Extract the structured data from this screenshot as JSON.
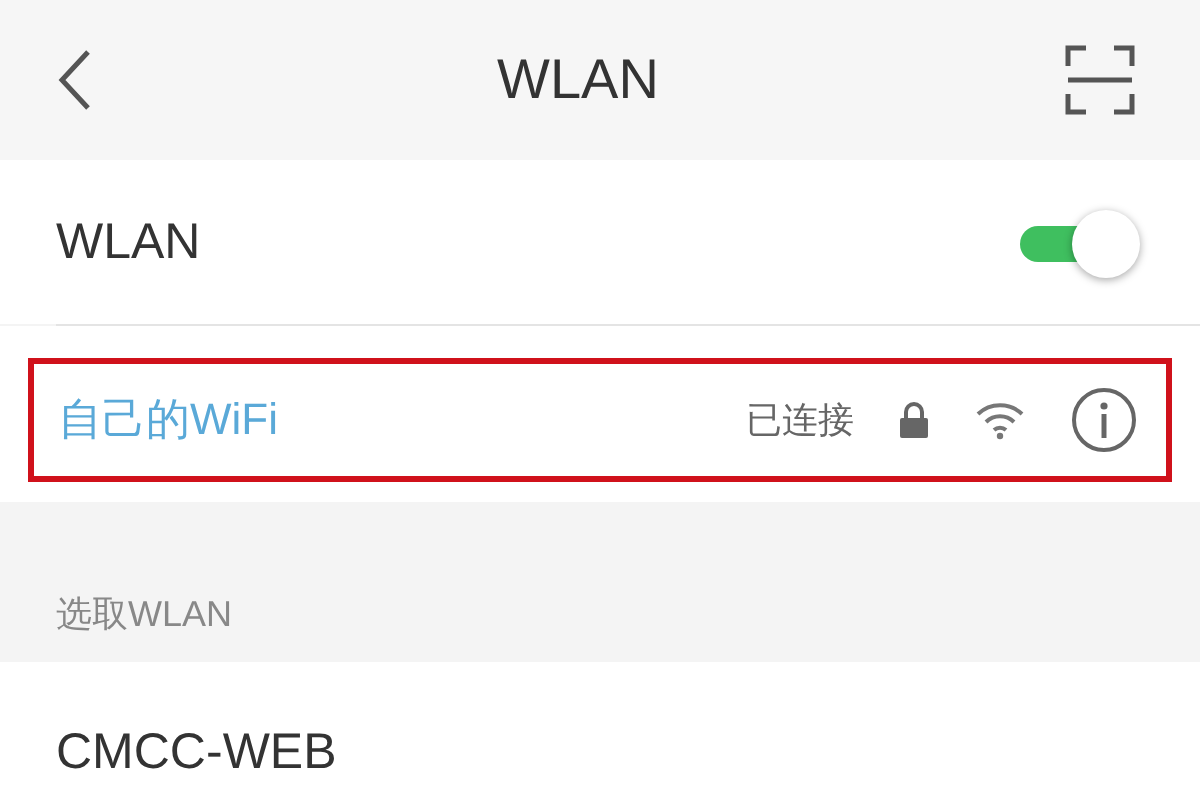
{
  "header": {
    "title": "WLAN"
  },
  "wlan_switch": {
    "label": "WLAN",
    "on": true
  },
  "connected": {
    "name": "自己的WiFi",
    "status": "已连接",
    "highlighted": true
  },
  "section": {
    "label": "选取WLAN"
  },
  "networks": [
    {
      "name": "CMCC-WEB"
    }
  ]
}
